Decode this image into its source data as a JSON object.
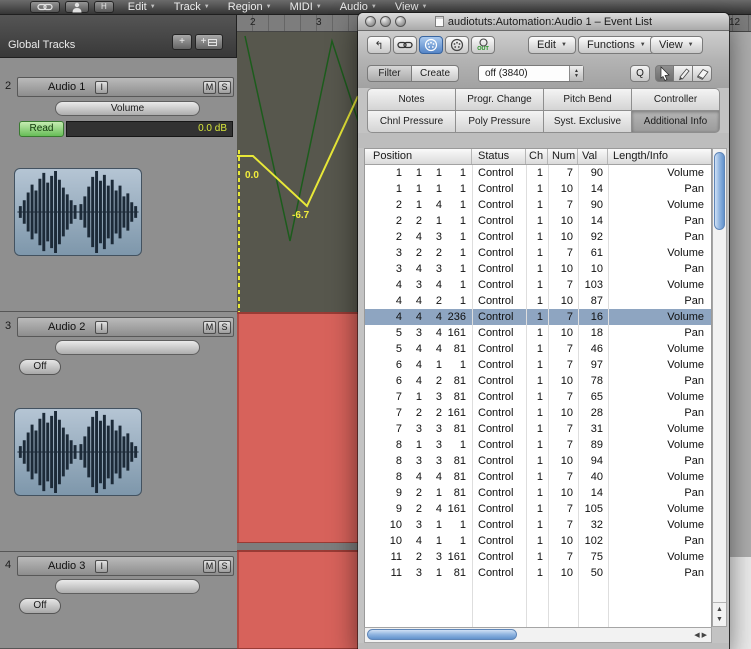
{
  "menubar": {
    "h_icon_label": "H",
    "items": [
      "Edit",
      "Track",
      "Region",
      "MIDI",
      "Audio",
      "View"
    ]
  },
  "arrange": {
    "global_tracks": {
      "label": "Global Tracks",
      "add_label": "+",
      "add_grid_label": "+"
    },
    "ruler": {
      "marks": [
        "2",
        "3",
        "12"
      ]
    },
    "automation": {
      "value_high": "0.0",
      "value_low": "-6.7"
    },
    "tracks": [
      {
        "number": "2",
        "name": "Audio 1",
        "input_button": "I",
        "mute_button": "M",
        "solo_button": "S",
        "param_label": "Volume",
        "mode_label": "Read",
        "value_display": "0.0 dB"
      },
      {
        "number": "3",
        "name": "Audio 2",
        "input_button": "I",
        "mute_button": "M",
        "solo_button": "S",
        "mode_label": "Off"
      },
      {
        "number": "4",
        "name": "Audio 3",
        "input_button": "I",
        "mute_button": "M",
        "solo_button": "S",
        "mode_label": "Off"
      }
    ]
  },
  "event_list": {
    "title": "audiotuts:Automation:Audio 1 – Event List",
    "toolbar": {
      "menus": [
        "Edit",
        "Functions",
        "View"
      ],
      "out_label": "OUT"
    },
    "controls": {
      "filter": "Filter",
      "create": "Create",
      "quantize_value": "off (3840)",
      "quantize_apply": "Q"
    },
    "filter_buttons": [
      "Notes",
      "Progr. Change",
      "Pitch Bend",
      "Controller",
      "Chnl Pressure",
      "Poly Pressure",
      "Syst. Exclusive",
      "Additional Info"
    ],
    "active_filter": "Additional Info",
    "colors": {
      "selection": "#8ea5c1",
      "region_red": "#d7625b",
      "automation_yellow": "#e8e838",
      "automation_green": "#1c5c1c"
    },
    "table": {
      "columns": [
        "Position",
        "Status",
        "Ch",
        "Num",
        "Val",
        "Length/Info"
      ],
      "rows": [
        {
          "pos": [
            "1",
            "1",
            "1",
            "1"
          ],
          "status": "Control",
          "ch": "1",
          "num": "7",
          "val": "90",
          "info": "Volume"
        },
        {
          "pos": [
            "1",
            "1",
            "1",
            "1"
          ],
          "status": "Control",
          "ch": "1",
          "num": "10",
          "val": "14",
          "info": "Pan"
        },
        {
          "pos": [
            "2",
            "1",
            "4",
            "1"
          ],
          "status": "Control",
          "ch": "1",
          "num": "7",
          "val": "90",
          "info": "Volume"
        },
        {
          "pos": [
            "2",
            "2",
            "1",
            "1"
          ],
          "status": "Control",
          "ch": "1",
          "num": "10",
          "val": "14",
          "info": "Pan"
        },
        {
          "pos": [
            "2",
            "4",
            "3",
            "1"
          ],
          "status": "Control",
          "ch": "1",
          "num": "10",
          "val": "92",
          "info": "Pan"
        },
        {
          "pos": [
            "3",
            "2",
            "2",
            "1"
          ],
          "status": "Control",
          "ch": "1",
          "num": "7",
          "val": "61",
          "info": "Volume"
        },
        {
          "pos": [
            "3",
            "4",
            "3",
            "1"
          ],
          "status": "Control",
          "ch": "1",
          "num": "10",
          "val": "10",
          "info": "Pan"
        },
        {
          "pos": [
            "4",
            "3",
            "4",
            "1"
          ],
          "status": "Control",
          "ch": "1",
          "num": "7",
          "val": "103",
          "info": "Volume"
        },
        {
          "pos": [
            "4",
            "4",
            "2",
            "1"
          ],
          "status": "Control",
          "ch": "1",
          "num": "10",
          "val": "87",
          "info": "Pan"
        },
        {
          "pos": [
            "4",
            "4",
            "4",
            "236"
          ],
          "status": "Control",
          "ch": "1",
          "num": "7",
          "val": "16",
          "info": "Volume",
          "selected": true
        },
        {
          "pos": [
            "5",
            "3",
            "4",
            "161"
          ],
          "status": "Control",
          "ch": "1",
          "num": "10",
          "val": "18",
          "info": "Pan"
        },
        {
          "pos": [
            "5",
            "4",
            "4",
            "81"
          ],
          "status": "Control",
          "ch": "1",
          "num": "7",
          "val": "46",
          "info": "Volume"
        },
        {
          "pos": [
            "6",
            "4",
            "1",
            "1"
          ],
          "status": "Control",
          "ch": "1",
          "num": "7",
          "val": "97",
          "info": "Volume"
        },
        {
          "pos": [
            "6",
            "4",
            "2",
            "81"
          ],
          "status": "Control",
          "ch": "1",
          "num": "10",
          "val": "78",
          "info": "Pan"
        },
        {
          "pos": [
            "7",
            "1",
            "3",
            "81"
          ],
          "status": "Control",
          "ch": "1",
          "num": "7",
          "val": "65",
          "info": "Volume"
        },
        {
          "pos": [
            "7",
            "2",
            "2",
            "161"
          ],
          "status": "Control",
          "ch": "1",
          "num": "10",
          "val": "28",
          "info": "Pan"
        },
        {
          "pos": [
            "7",
            "3",
            "3",
            "81"
          ],
          "status": "Control",
          "ch": "1",
          "num": "7",
          "val": "31",
          "info": "Volume"
        },
        {
          "pos": [
            "8",
            "1",
            "3",
            "1"
          ],
          "status": "Control",
          "ch": "1",
          "num": "7",
          "val": "89",
          "info": "Volume"
        },
        {
          "pos": [
            "8",
            "3",
            "3",
            "81"
          ],
          "status": "Control",
          "ch": "1",
          "num": "10",
          "val": "94",
          "info": "Pan"
        },
        {
          "pos": [
            "8",
            "4",
            "4",
            "81"
          ],
          "status": "Control",
          "ch": "1",
          "num": "7",
          "val": "40",
          "info": "Volume"
        },
        {
          "pos": [
            "9",
            "2",
            "1",
            "81"
          ],
          "status": "Control",
          "ch": "1",
          "num": "10",
          "val": "14",
          "info": "Pan"
        },
        {
          "pos": [
            "9",
            "2",
            "4",
            "161"
          ],
          "status": "Control",
          "ch": "1",
          "num": "7",
          "val": "105",
          "info": "Volume"
        },
        {
          "pos": [
            "10",
            "3",
            "1",
            "1"
          ],
          "status": "Control",
          "ch": "1",
          "num": "7",
          "val": "32",
          "info": "Volume"
        },
        {
          "pos": [
            "10",
            "4",
            "1",
            "1"
          ],
          "status": "Control",
          "ch": "1",
          "num": "10",
          "val": "102",
          "info": "Pan"
        },
        {
          "pos": [
            "11",
            "2",
            "3",
            "161"
          ],
          "status": "Control",
          "ch": "1",
          "num": "7",
          "val": "75",
          "info": "Volume"
        },
        {
          "pos": [
            "11",
            "3",
            "1",
            "81"
          ],
          "status": "Control",
          "ch": "1",
          "num": "10",
          "val": "50",
          "info": "Pan"
        }
      ]
    }
  }
}
